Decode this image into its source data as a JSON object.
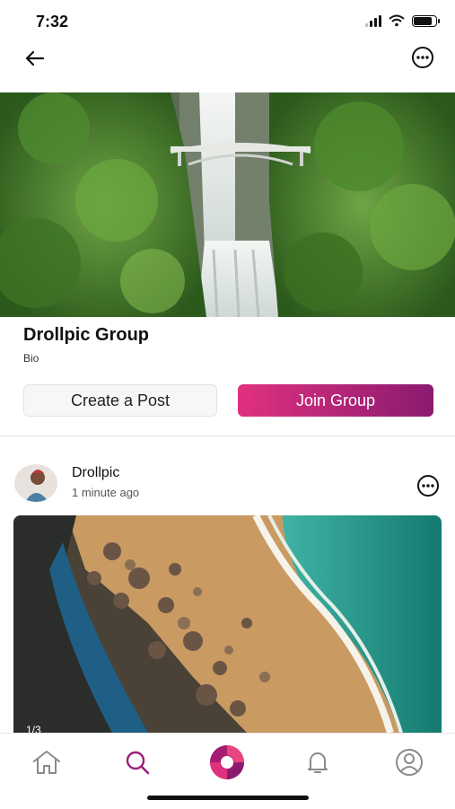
{
  "status": {
    "time": "7:32"
  },
  "group": {
    "name": "Drollpic Group",
    "bio": "Bio",
    "create_post_label": "Create a Post",
    "join_label": "Join Group"
  },
  "post": {
    "author": "Drollpic",
    "time": "1 minute ago",
    "image_counter": "1/3"
  },
  "tabs": [
    {
      "icon": "home-icon"
    },
    {
      "icon": "search-icon",
      "active": true
    },
    {
      "icon": "camera-aperture-icon"
    },
    {
      "icon": "bell-icon"
    },
    {
      "icon": "profile-icon"
    }
  ],
  "colors": {
    "accent": "#9b1f7a",
    "gradient_start": "#e0317e",
    "gradient_end": "#8a1a70"
  }
}
